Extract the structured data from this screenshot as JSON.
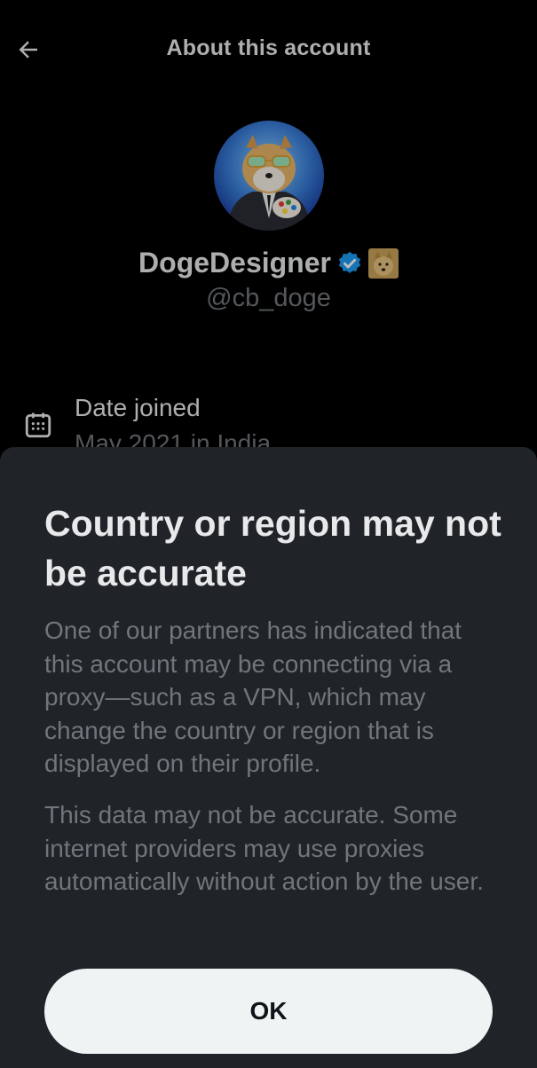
{
  "header": {
    "title": "About this account",
    "back_icon": "arrow-left-icon"
  },
  "profile": {
    "display_name": "DogeDesigner",
    "handle": "@cb_doge",
    "verified_icon": "verified-badge-icon",
    "verified_color": "#1d9bf0",
    "emoji_icon": "doge-emoji-icon"
  },
  "details": {
    "date_joined_label": "Date joined",
    "date_joined_value": "May 2021 in India",
    "icon": "calendar-icon"
  },
  "sheet": {
    "title": "Country or region may not be accurate",
    "paragraph1": "One of our partners has indicated that this account may be connecting via a proxy—such as a VPN, which may change the country or region that is displayed on their profile.",
    "paragraph2": "This data may not be accurate. Some internet providers may use proxies automatically without action by the user.",
    "ok_label": "OK"
  },
  "colors": {
    "background": "#000000",
    "sheet_background": "#202327",
    "primary_text": "#e7e9ea",
    "secondary_text": "#71767b",
    "button_background": "#eff3f4"
  }
}
